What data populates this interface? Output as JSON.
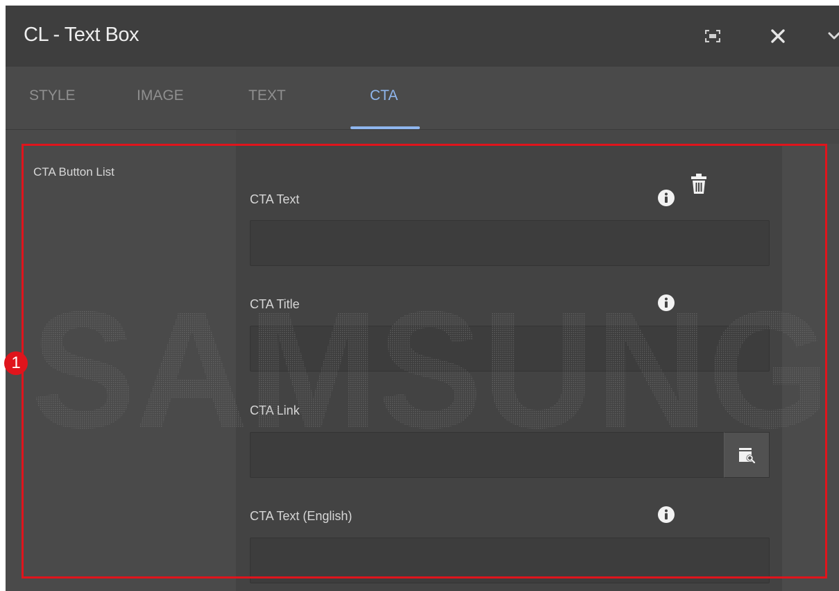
{
  "dialog": {
    "title": "CL - Text Box"
  },
  "toolbar": {
    "fullscreen_icon": "fullscreen-icon",
    "close_icon": "close-icon",
    "collapse_icon": "chevron-down-icon"
  },
  "tabs": [
    {
      "label": "STYLE",
      "active": false
    },
    {
      "label": "IMAGE",
      "active": false
    },
    {
      "label": "TEXT",
      "active": false
    },
    {
      "label": "CTA",
      "active": true
    }
  ],
  "section": {
    "label": "CTA Button List"
  },
  "fields": {
    "cta_text": {
      "label": "CTA Text",
      "value": ""
    },
    "cta_title": {
      "label": "CTA Title",
      "value": ""
    },
    "cta_link": {
      "label": "CTA Link",
      "value": ""
    },
    "cta_text_english": {
      "label": "CTA Text (English)",
      "value": ""
    }
  },
  "annotation": {
    "badge": "1"
  },
  "watermark": {
    "text": "SAMSUNG"
  },
  "colors": {
    "accent": "#8fb6ee",
    "highlight": "#e0141c",
    "background": "#474747"
  }
}
